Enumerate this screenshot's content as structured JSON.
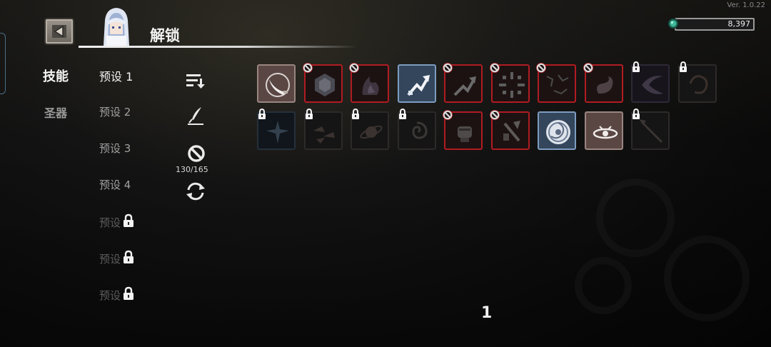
{
  "version": "Ver. 1.0.22",
  "header": {
    "back_icon": "left-arrow-icon",
    "title": "解锁",
    "portrait_icon": "character-portrait"
  },
  "currency": {
    "icon": "gem-icon",
    "value": "8,397"
  },
  "categories": [
    {
      "label": "技能",
      "active": true
    },
    {
      "label": "圣器",
      "active": false
    }
  ],
  "presets": [
    {
      "label": "预设 1",
      "state": "active"
    },
    {
      "label": "预设 2",
      "state": "normal"
    },
    {
      "label": "预设 3",
      "state": "normal"
    },
    {
      "label": "预设 4",
      "state": "normal"
    },
    {
      "label": "预设",
      "state": "locked"
    },
    {
      "label": "预设",
      "state": "locked"
    },
    {
      "label": "预设",
      "state": "locked"
    }
  ],
  "tools": {
    "sort_icon": "sort-icon",
    "edit_icon": "feather-pen-icon",
    "ban_icon": "ban-icon",
    "ban_count": "130/165",
    "refresh_icon": "refresh-icon"
  },
  "skills": [
    {
      "icon": "sword-slash-icon",
      "state": "equipped"
    },
    {
      "icon": "hex-shield-icon",
      "state": "banned"
    },
    {
      "icon": "dark-flame-icon",
      "state": "banned"
    },
    {
      "icon": "rising-arrow-icon",
      "state": "selected"
    },
    {
      "icon": "arrow-up-icon",
      "state": "banned"
    },
    {
      "icon": "burst-icon",
      "state": "banned"
    },
    {
      "icon": "scatter-icon",
      "state": "banned"
    },
    {
      "icon": "serpent-icon",
      "state": "banned"
    },
    {
      "icon": "claw-icon",
      "state": "locked"
    },
    {
      "icon": "vortex-icon",
      "state": "locked"
    },
    {
      "icon": "starburst-icon",
      "state": "locked"
    },
    {
      "icon": "shards-icon",
      "state": "locked"
    },
    {
      "icon": "planet-icon",
      "state": "locked"
    },
    {
      "icon": "spiral-icon",
      "state": "locked"
    },
    {
      "icon": "fist-icon",
      "state": "banned"
    },
    {
      "icon": "strike-icon",
      "state": "banned"
    },
    {
      "icon": "portal-icon",
      "state": "selected"
    },
    {
      "icon": "orbit-icon",
      "state": "equipped"
    },
    {
      "icon": "spear-icon",
      "state": "locked"
    }
  ],
  "page_number": "1"
}
